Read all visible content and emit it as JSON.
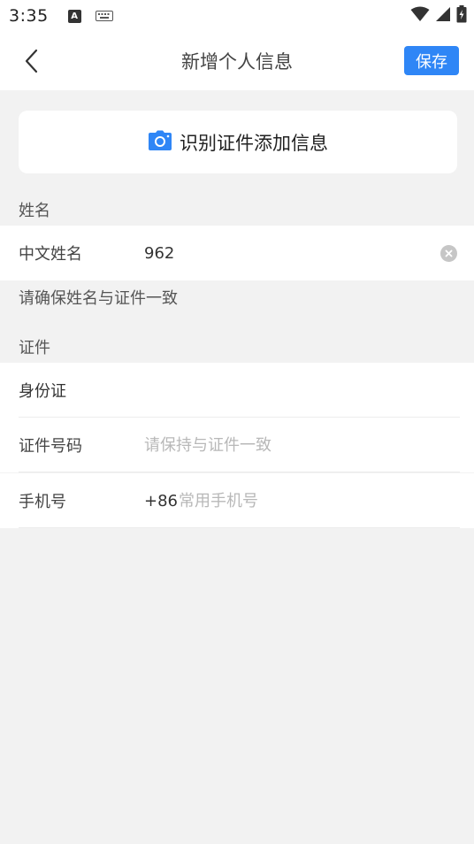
{
  "status_bar": {
    "time": "3:35",
    "a_badge": "A"
  },
  "header": {
    "title": "新增个人信息",
    "save_label": "保存"
  },
  "scan_card": {
    "label": "识别证件添加信息"
  },
  "name_section": {
    "section_label": "姓名",
    "chinese_name_label": "中文姓名",
    "chinese_name_value": "962",
    "hint": "请确保姓名与证件一致"
  },
  "id_section": {
    "section_label": "证件",
    "id_type": "身份证",
    "id_number_label": "证件号码",
    "id_number_placeholder": "请保持与证件一致",
    "phone_label": "手机号",
    "phone_prefix": "+86",
    "phone_placeholder": "常用手机号"
  },
  "colors": {
    "accent": "#2f86f6",
    "background": "#f2f2f2"
  }
}
